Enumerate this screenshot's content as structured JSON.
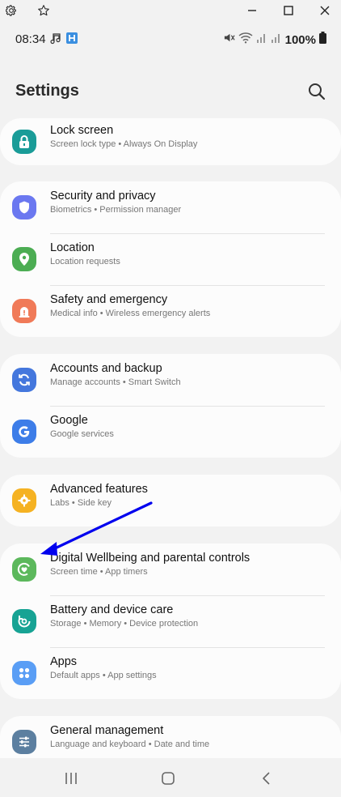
{
  "window_bar": {
    "icons": [
      "gear-icon",
      "star-icon",
      "minimize-icon",
      "maximize-icon",
      "close-icon"
    ]
  },
  "status_bar": {
    "time": "08:34",
    "battery": "100%"
  },
  "header": {
    "title": "Settings"
  },
  "items": [
    {
      "title": "Lock screen",
      "subtitle": "Screen lock type  •  Always On Display",
      "icon": "lock-icon",
      "color": "#1a9c98"
    },
    {
      "title": "Security and privacy",
      "subtitle": "Biometrics  •  Permission manager",
      "icon": "shield-icon",
      "color": "#6b78f0"
    },
    {
      "title": "Location",
      "subtitle": "Location requests",
      "icon": "location-pin-icon",
      "color": "#4cad53"
    },
    {
      "title": "Safety and emergency",
      "subtitle": "Medical info  •  Wireless emergency alerts",
      "icon": "emergency-icon",
      "color": "#f07a58"
    },
    {
      "title": "Accounts and backup",
      "subtitle": "Manage accounts  •  Smart Switch",
      "icon": "sync-icon",
      "color": "#4477dd"
    },
    {
      "title": "Google",
      "subtitle": "Google services",
      "icon": "google-icon",
      "color": "#3d7de8"
    },
    {
      "title": "Advanced features",
      "subtitle": "Labs  •  Side key",
      "icon": "puzzle-gear-icon",
      "color": "#f5b222"
    },
    {
      "title": "Digital Wellbeing and parental controls",
      "subtitle": "Screen time  •  App timers",
      "icon": "wellbeing-heart-icon",
      "color": "#5cb85c"
    },
    {
      "title": "Battery and device care",
      "subtitle": "Storage  •  Memory  •  Device protection",
      "icon": "device-care-icon",
      "color": "#17a394"
    },
    {
      "title": "Apps",
      "subtitle": "Default apps  •  App settings",
      "icon": "apps-grid-icon",
      "color": "#5a9ef5"
    },
    {
      "title": "General management",
      "subtitle": "Language and keyboard  •  Date and time",
      "icon": "sliders-icon",
      "color": "#5c7fa0"
    }
  ],
  "annotation": {
    "arrow_color": "#0000ee"
  }
}
